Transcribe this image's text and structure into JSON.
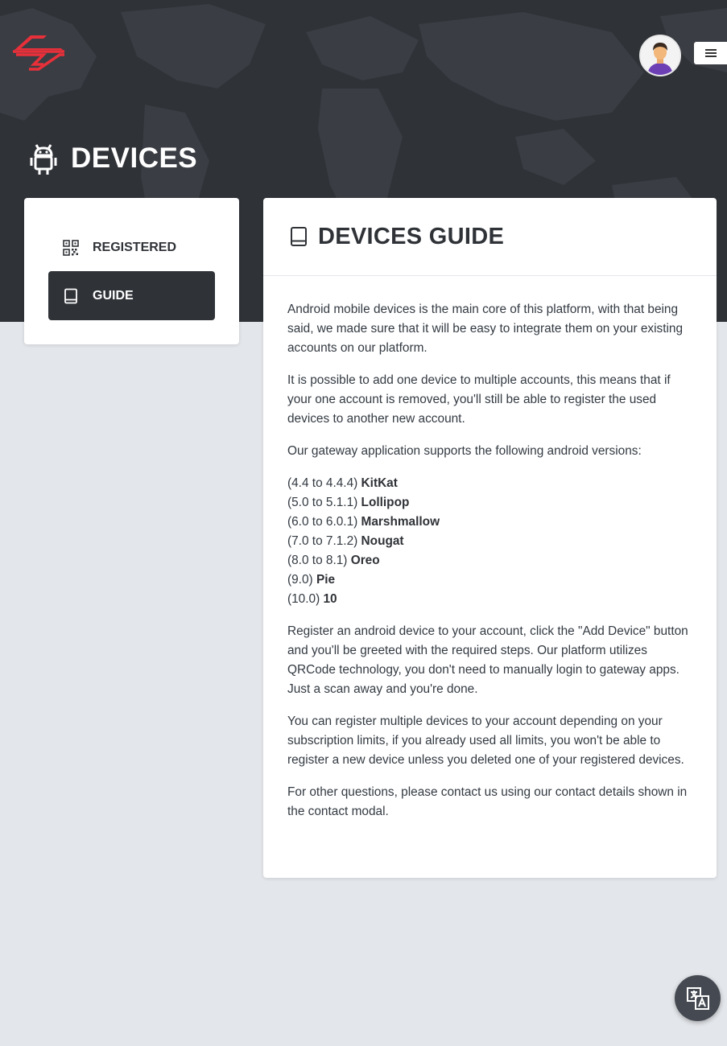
{
  "header": {
    "logo_icon": "brand-logo",
    "avatar_icon": "user-avatar",
    "menu_icon": "hamburger-menu-icon"
  },
  "page": {
    "title": "DEVICES",
    "title_icon": "android-icon"
  },
  "sidebar": {
    "items": [
      {
        "label": "REGISTERED",
        "icon": "qrcode-icon",
        "active": false
      },
      {
        "label": "GUIDE",
        "icon": "book-icon",
        "active": true
      }
    ]
  },
  "guide": {
    "title": "DEVICES GUIDE",
    "icon": "book-icon",
    "paragraphs": [
      "Android mobile devices is the main core of this platform, with that being said, we made sure that it will be easy to integrate them on your existing accounts on our platform.",
      "It is possible to add one device to multiple accounts, this means that if your one account is removed, you'll still be able to register the used devices to another new account.",
      "Our gateway application supports the following android versions:",
      "Register an android device to your account, click the \"Add Device\" button and you'll be greeted with the required steps. Our platform utilizes QRCode technology, you don't need to manually login to gateway apps. Just a scan away and you're done.",
      "You can register multiple devices to your account depending on your subscription limits, if you already used all limits, you won't be able to register a new device unless you deleted one of your registered devices.",
      "For other questions, please contact us using our contact details shown in the contact modal."
    ],
    "versions": [
      {
        "range": "(4.4 to 4.4.4)",
        "name": "KitKat"
      },
      {
        "range": "(5.0 to 5.1.1)",
        "name": "Lollipop"
      },
      {
        "range": "(6.0 to 6.0.1)",
        "name": "Marshmallow"
      },
      {
        "range": "(7.0 to 7.1.2)",
        "name": "Nougat"
      },
      {
        "range": "(8.0 to 8.1)",
        "name": "Oreo"
      },
      {
        "range": "(9.0)",
        "name": "Pie"
      },
      {
        "range": "(10.0)",
        "name": "10"
      }
    ]
  },
  "floating": {
    "translate_icon": "translate-icon"
  },
  "colors": {
    "header_bg": "#2f3237",
    "page_bg": "#e3e6ea",
    "accent": "#e8303a",
    "active_item": "#2f3237"
  }
}
